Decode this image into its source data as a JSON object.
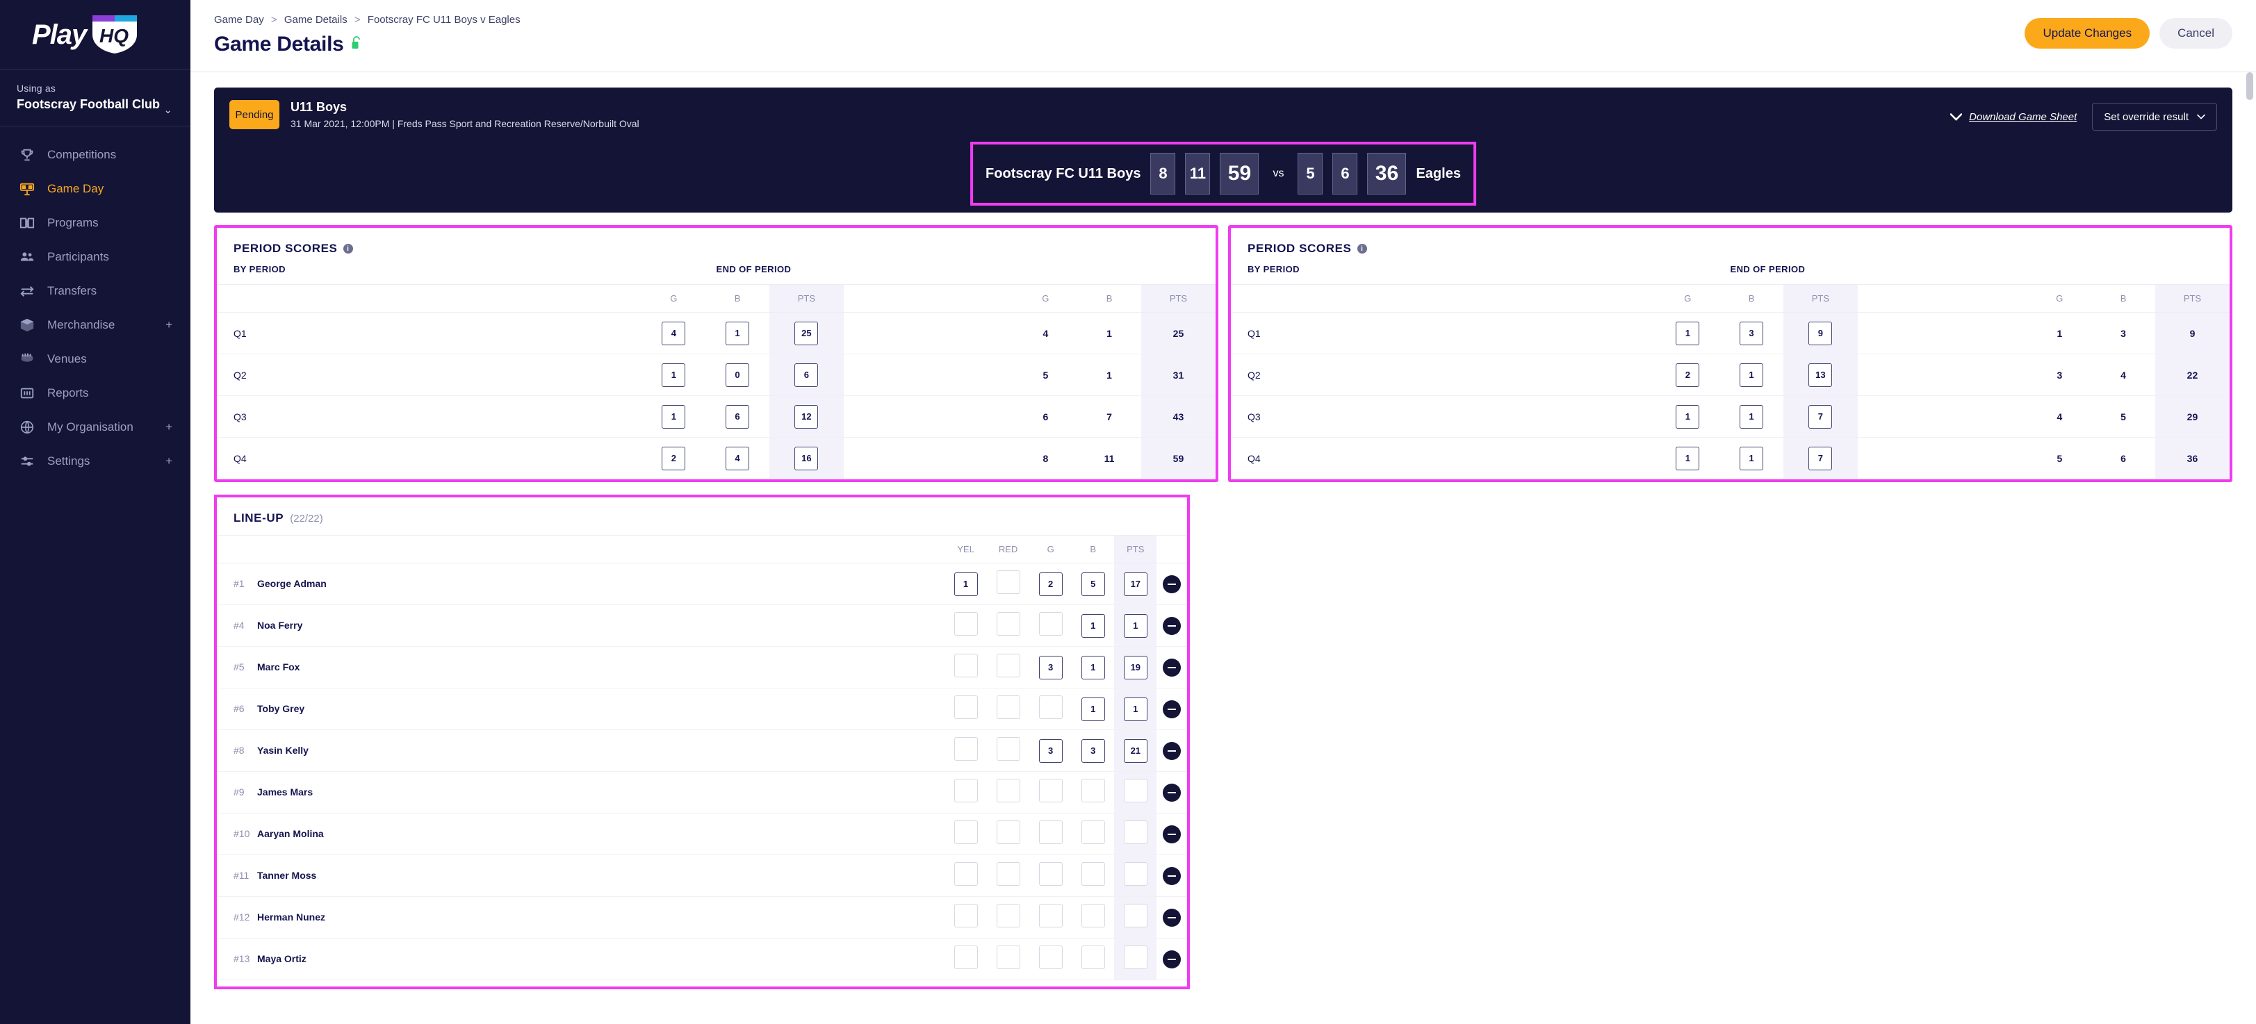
{
  "sidebar": {
    "logo": {
      "word1": "Play",
      "word2": "HQ"
    },
    "using_as_label": "Using as",
    "using_as_value": "Footscray Football Club",
    "items": [
      {
        "label": "Competitions",
        "icon": "trophy-icon",
        "active": false,
        "expandable": false
      },
      {
        "label": "Game Day",
        "icon": "scoreboard-icon",
        "active": true,
        "expandable": false
      },
      {
        "label": "Programs",
        "icon": "book-icon",
        "active": false,
        "expandable": false
      },
      {
        "label": "Participants",
        "icon": "people-icon",
        "active": false,
        "expandable": false
      },
      {
        "label": "Transfers",
        "icon": "transfer-arrows-icon",
        "active": false,
        "expandable": false
      },
      {
        "label": "Merchandise",
        "icon": "box-icon",
        "active": false,
        "expandable": true
      },
      {
        "label": "Venues",
        "icon": "stadium-icon",
        "active": false,
        "expandable": false
      },
      {
        "label": "Reports",
        "icon": "bar-chart-icon",
        "active": false,
        "expandable": false
      },
      {
        "label": "My Organisation",
        "icon": "globe-icon",
        "active": false,
        "expandable": true
      },
      {
        "label": "Settings",
        "icon": "sliders-icon",
        "active": false,
        "expandable": true
      }
    ],
    "expand_symbol": "+"
  },
  "topbar": {
    "breadcrumb": [
      "Game Day",
      "Game Details",
      "Footscray FC U11 Boys v Eagles"
    ],
    "breadcrumb_separator": ">",
    "page_title": "Game Details",
    "lock_state": "unlocked",
    "update_label": "Update Changes",
    "cancel_label": "Cancel"
  },
  "game": {
    "status_badge": "Pending",
    "title": "U11 Boys",
    "subtitle": "31 Mar 2021, 12:00PM | Freds Pass Sport and Recreation Reserve/Norbuilt Oval",
    "download_label": "Download Game Sheet",
    "override_label": "Set override result",
    "scoreline": {
      "home_team": "Footscray FC U11 Boys",
      "home_goals": "8",
      "home_behinds": "11",
      "home_points": "59",
      "vs": "vs",
      "away_goals": "5",
      "away_behinds": "6",
      "away_points": "36",
      "away_team": "Eagles"
    }
  },
  "period_scores": {
    "title": "PERIOD SCORES",
    "by_period_label": "BY PERIOD",
    "end_of_period_label": "END OF PERIOD",
    "columns": [
      "G",
      "B",
      "PTS"
    ],
    "home": {
      "rows": [
        {
          "period": "Q1",
          "by": {
            "g": "4",
            "b": "1",
            "pts": "25"
          },
          "end": {
            "g": "4",
            "b": "1",
            "pts": "25"
          }
        },
        {
          "period": "Q2",
          "by": {
            "g": "1",
            "b": "0",
            "pts": "6"
          },
          "end": {
            "g": "5",
            "b": "1",
            "pts": "31"
          }
        },
        {
          "period": "Q3",
          "by": {
            "g": "1",
            "b": "6",
            "pts": "12"
          },
          "end": {
            "g": "6",
            "b": "7",
            "pts": "43"
          }
        },
        {
          "period": "Q4",
          "by": {
            "g": "2",
            "b": "4",
            "pts": "16"
          },
          "end": {
            "g": "8",
            "b": "11",
            "pts": "59"
          }
        }
      ]
    },
    "away": {
      "rows": [
        {
          "period": "Q1",
          "by": {
            "g": "1",
            "b": "3",
            "pts": "9"
          },
          "end": {
            "g": "1",
            "b": "3",
            "pts": "9"
          }
        },
        {
          "period": "Q2",
          "by": {
            "g": "2",
            "b": "1",
            "pts": "13"
          },
          "end": {
            "g": "3",
            "b": "4",
            "pts": "22"
          }
        },
        {
          "period": "Q3",
          "by": {
            "g": "1",
            "b": "1",
            "pts": "7"
          },
          "end": {
            "g": "4",
            "b": "5",
            "pts": "29"
          }
        },
        {
          "period": "Q4",
          "by": {
            "g": "1",
            "b": "1",
            "pts": "7"
          },
          "end": {
            "g": "5",
            "b": "6",
            "pts": "36"
          }
        }
      ]
    }
  },
  "lineup": {
    "title": "LINE-UP",
    "count": "(22/22)",
    "columns": [
      "YEL",
      "RED",
      "G",
      "B",
      "PTS"
    ],
    "players": [
      {
        "number": "#1",
        "name": "George Adman",
        "yel": "1",
        "red": "",
        "g": "2",
        "b": "5",
        "pts": "17"
      },
      {
        "number": "#4",
        "name": "Noa Ferry",
        "yel": "",
        "red": "",
        "g": "",
        "b": "1",
        "pts": "1"
      },
      {
        "number": "#5",
        "name": "Marc Fox",
        "yel": "",
        "red": "",
        "g": "3",
        "b": "1",
        "pts": "19"
      },
      {
        "number": "#6",
        "name": "Toby Grey",
        "yel": "",
        "red": "",
        "g": "",
        "b": "1",
        "pts": "1"
      },
      {
        "number": "#8",
        "name": "Yasin Kelly",
        "yel": "",
        "red": "",
        "g": "3",
        "b": "3",
        "pts": "21"
      },
      {
        "number": "#9",
        "name": "James Mars",
        "yel": "",
        "red": "",
        "g": "",
        "b": "",
        "pts": ""
      },
      {
        "number": "#10",
        "name": "Aaryan Molina",
        "yel": "",
        "red": "",
        "g": "",
        "b": "",
        "pts": ""
      },
      {
        "number": "#11",
        "name": "Tanner Moss",
        "yel": "",
        "red": "",
        "g": "",
        "b": "",
        "pts": ""
      },
      {
        "number": "#12",
        "name": "Herman Nunez",
        "yel": "",
        "red": "",
        "g": "",
        "b": "",
        "pts": ""
      },
      {
        "number": "#13",
        "name": "Maya Ortiz",
        "yel": "",
        "red": "",
        "g": "",
        "b": "",
        "pts": ""
      }
    ],
    "remove_icon": "minus-circle-icon"
  },
  "colors": {
    "sidebar_bg": "#141436",
    "accent_orange": "#FBA91A",
    "highlight_pink": "#ef3cf0",
    "pts_column_bg": "#f3f2fb",
    "text_dark": "#141450",
    "lock_green": "#2ECC71"
  }
}
